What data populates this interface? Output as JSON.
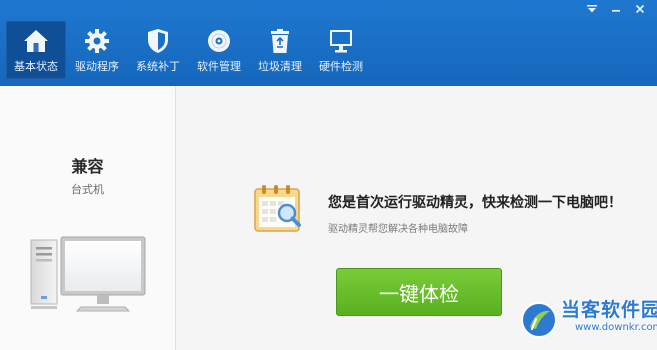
{
  "window": {
    "controls": [
      {
        "name": "menu-dropdown"
      },
      {
        "name": "minimize"
      },
      {
        "name": "close"
      }
    ]
  },
  "nav": {
    "items": [
      {
        "label": "基本状态",
        "icon": "home-icon",
        "active": true
      },
      {
        "label": "驱动程序",
        "icon": "gear-icon",
        "active": false
      },
      {
        "label": "系统补丁",
        "icon": "shield-icon",
        "active": false
      },
      {
        "label": "软件管理",
        "icon": "disc-icon",
        "active": false
      },
      {
        "label": "垃圾清理",
        "icon": "recycle-bin-icon",
        "active": false
      },
      {
        "label": "硬件检测",
        "icon": "monitor-icon",
        "active": false
      }
    ]
  },
  "sidebar": {
    "model_name": "兼容",
    "model_type": "台式机"
  },
  "main": {
    "headline": "您是首次运行驱动精灵，快来检测一下电脑吧！",
    "subtext": "驱动精灵帮您解决各种电脑故障",
    "check_button": "一键体检"
  },
  "watermark": {
    "title": "当客软件园",
    "url": "www.downkr.com"
  },
  "colors": {
    "titlebar": "#1a6fc6",
    "active_tab": "#0f4f98",
    "button_green": "#6cbe2d",
    "watermark_blue": "#2c7bd1"
  }
}
